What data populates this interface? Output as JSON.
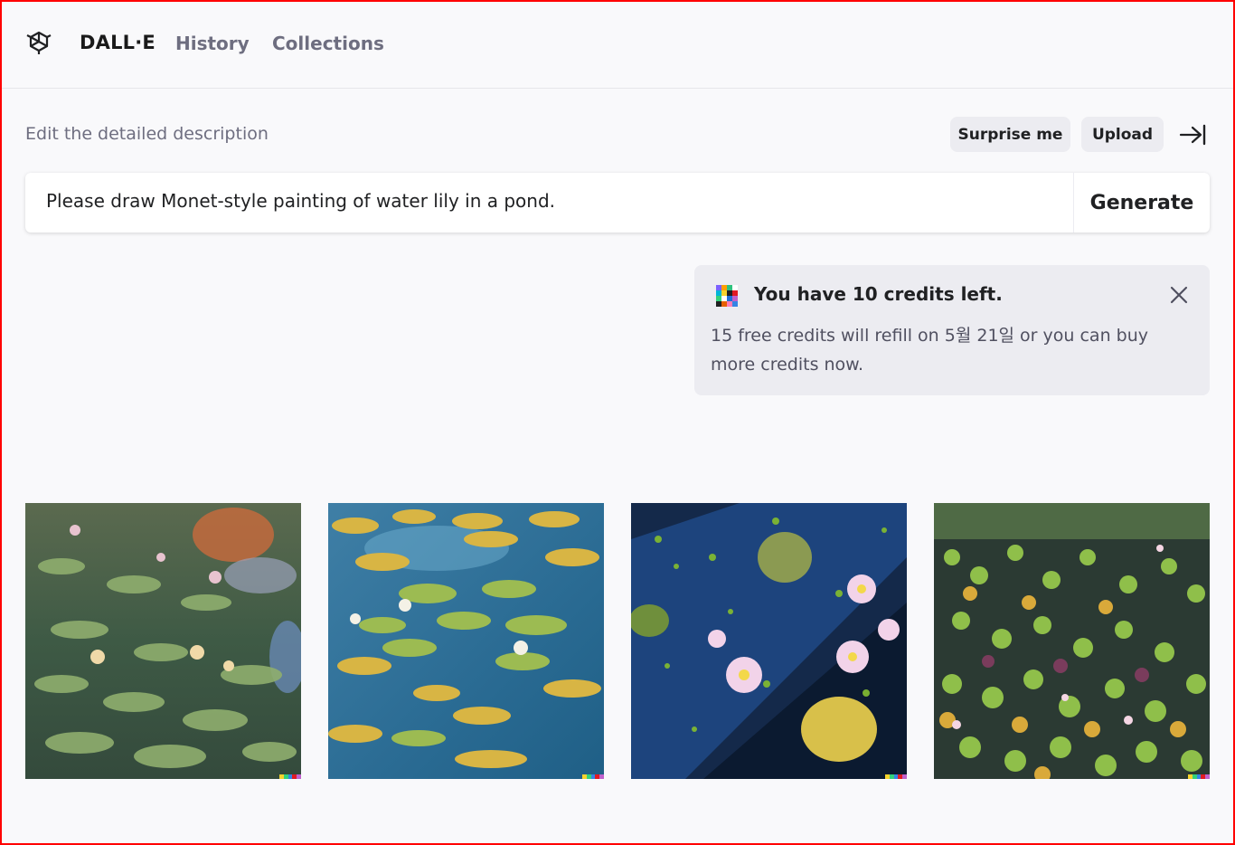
{
  "header": {
    "brand": "DALL·E",
    "nav": [
      {
        "label": "History"
      },
      {
        "label": "Collections"
      }
    ]
  },
  "prompt": {
    "label": "Edit the detailed description",
    "value": "Please draw Monet-style painting of water lily in a pond.",
    "surprise_label": "Surprise me",
    "upload_label": "Upload",
    "generate_label": "Generate"
  },
  "notice": {
    "title": "You have 10 credits left.",
    "body": "15 free credits will refill on 5월 21일 or you can buy more credits now."
  },
  "images": [
    {
      "name": "generated-image-1"
    },
    {
      "name": "generated-image-2"
    },
    {
      "name": "generated-image-3"
    },
    {
      "name": "generated-image-4"
    }
  ],
  "colors": {
    "background": "#f9f9fb",
    "pill": "#ececf1",
    "text": "#202123",
    "muted": "#6e6e80",
    "frame": "#ff0000"
  }
}
